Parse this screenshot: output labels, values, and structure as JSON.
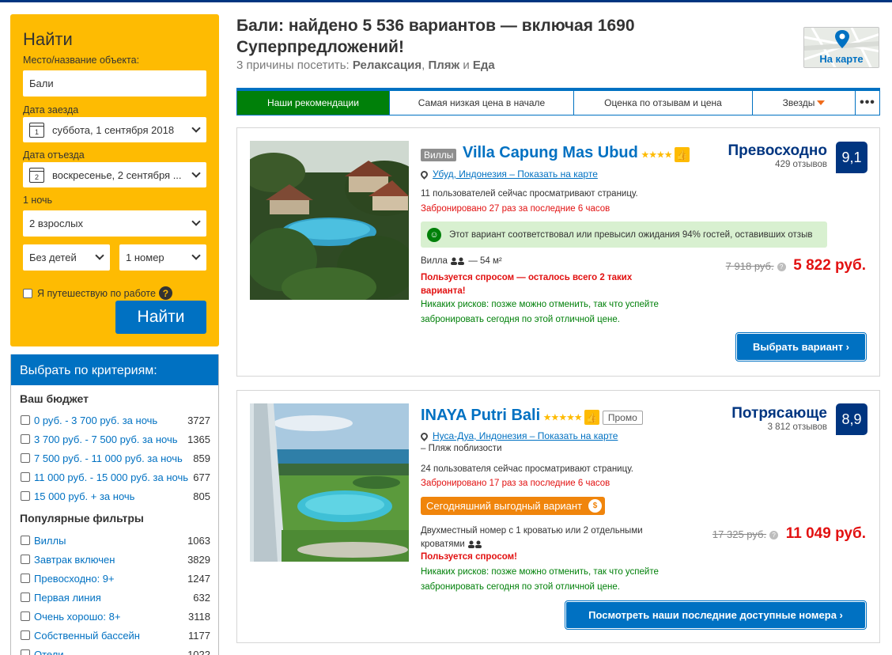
{
  "search": {
    "title": "Найти",
    "destination_label": "Место/название объекта:",
    "destination_value": "Бали",
    "checkin_label": "Дата заезда",
    "checkin_day": "1",
    "checkin_value": "суббота, 1 сентября 2018",
    "checkout_label": "Дата отъезда",
    "checkout_day": "2",
    "checkout_value": "воскресенье, 2 сентября ...",
    "nights": "1 ночь",
    "adults": "2 взрослых",
    "children": "Без детей",
    "rooms": "1 номер",
    "business_label": "Я путешествую по работе",
    "help_glyph": "?",
    "search_button": "Найти"
  },
  "filters": {
    "header": "Выбрать по критериям:",
    "budget_title": "Ваш бюджет",
    "budget": [
      {
        "label": "0 руб. - 3 700 руб. за ночь",
        "count": "3727"
      },
      {
        "label": "3 700 руб. - 7 500 руб. за ночь",
        "count": "1365"
      },
      {
        "label": "7 500 руб. - 11 000 руб. за ночь",
        "count": "859"
      },
      {
        "label": "11 000 руб. - 15 000 руб. за ночь",
        "count": "677"
      },
      {
        "label": "15 000 руб. + за ночь",
        "count": "805"
      }
    ],
    "popular_title": "Популярные фильтры",
    "popular": [
      {
        "label": "Виллы",
        "count": "1063"
      },
      {
        "label": "Завтрак включен",
        "count": "3829"
      },
      {
        "label": "Превосходно: 9+",
        "count": "1247"
      },
      {
        "label": "Первая линия",
        "count": "632"
      },
      {
        "label": "Очень хорошо: 8+",
        "count": "3118"
      },
      {
        "label": "Собственный бассейн",
        "count": "1177"
      },
      {
        "label": "Отели",
        "count": "1022"
      }
    ]
  },
  "header": {
    "title": "Бали: найдено 5 536 вариантов — включая 1690 Суперпредложений!",
    "reasons_prefix": "3 причины посетить:",
    "reason_1": "Релаксация",
    "sep_comma": ",",
    "reason_2": "Пляж",
    "sep_and": "и",
    "reason_3": "Еда",
    "map_button": "На карте"
  },
  "sort_tabs": [
    {
      "label": "Наши рекомендации",
      "active": true
    },
    {
      "label": "Самая низкая цена в начале",
      "active": false
    },
    {
      "label": "Оценка по отзывам и цена",
      "active": false
    },
    {
      "label": "Звезды",
      "active": false
    },
    {
      "label": "•••",
      "active": false
    }
  ],
  "hotels": [
    {
      "type": "Виллы",
      "name": "Villa Capung Mas Ubud",
      "stars": "★★★★",
      "location": "Убуд, Индонезия – Показать на карте",
      "viewers": "11 пользователей сейчас просматривают страницу.",
      "booked": "Забронировано 27 раз за последние 6 часов",
      "expectation": "Этот вариант соответствовал или превысил ожидания 94% гостей, оставивших отзыв",
      "room": "Вилла",
      "room_area": "— 54 м²",
      "demand": "Пользуется спросом — осталось всего 2 таких варианта!",
      "no_risk": "Никаких рисков: позже можно отменить, так что успейте забронировать сегодня по этой отличной цене.",
      "score_word": "Превосходно",
      "reviews": "429 отзывов",
      "score": "9,1",
      "old_price": "7 918 руб.",
      "price": "5 822 руб.",
      "cta": "Выбрать вариант ›"
    },
    {
      "name": "INAYA Putri Bali",
      "stars": "★★★★★",
      "promo": "Промо",
      "location": "Нуса-Дуа, Индонезия – Показать на карте",
      "beach": "– Пляж поблизости",
      "viewers": "24 пользователя сейчас просматривают страницу.",
      "booked": "Забронировано 17 раз за последние 6 часов",
      "deal": "Сегодняшний выгодный вариант",
      "room": "Двухместный номер с 1 кроватью или 2 отдельными кроватями",
      "demand": "Пользуется спросом!",
      "no_risk": "Никаких рисков: позже можно отменить, так что успейте забронировать сегодня по этой отличной цене.",
      "score_word": "Потрясающе",
      "reviews": "3 812 отзывов",
      "score": "8,9",
      "old_price": "17 325 руб.",
      "price": "11 049 руб.",
      "cta": "Посмотреть наши последние доступные номера ›"
    }
  ],
  "colors": {
    "brand_blue": "#003580",
    "link_blue": "#0071c2",
    "search_yellow": "#febb02",
    "active_green": "#008009",
    "price_red": "#e21111"
  }
}
